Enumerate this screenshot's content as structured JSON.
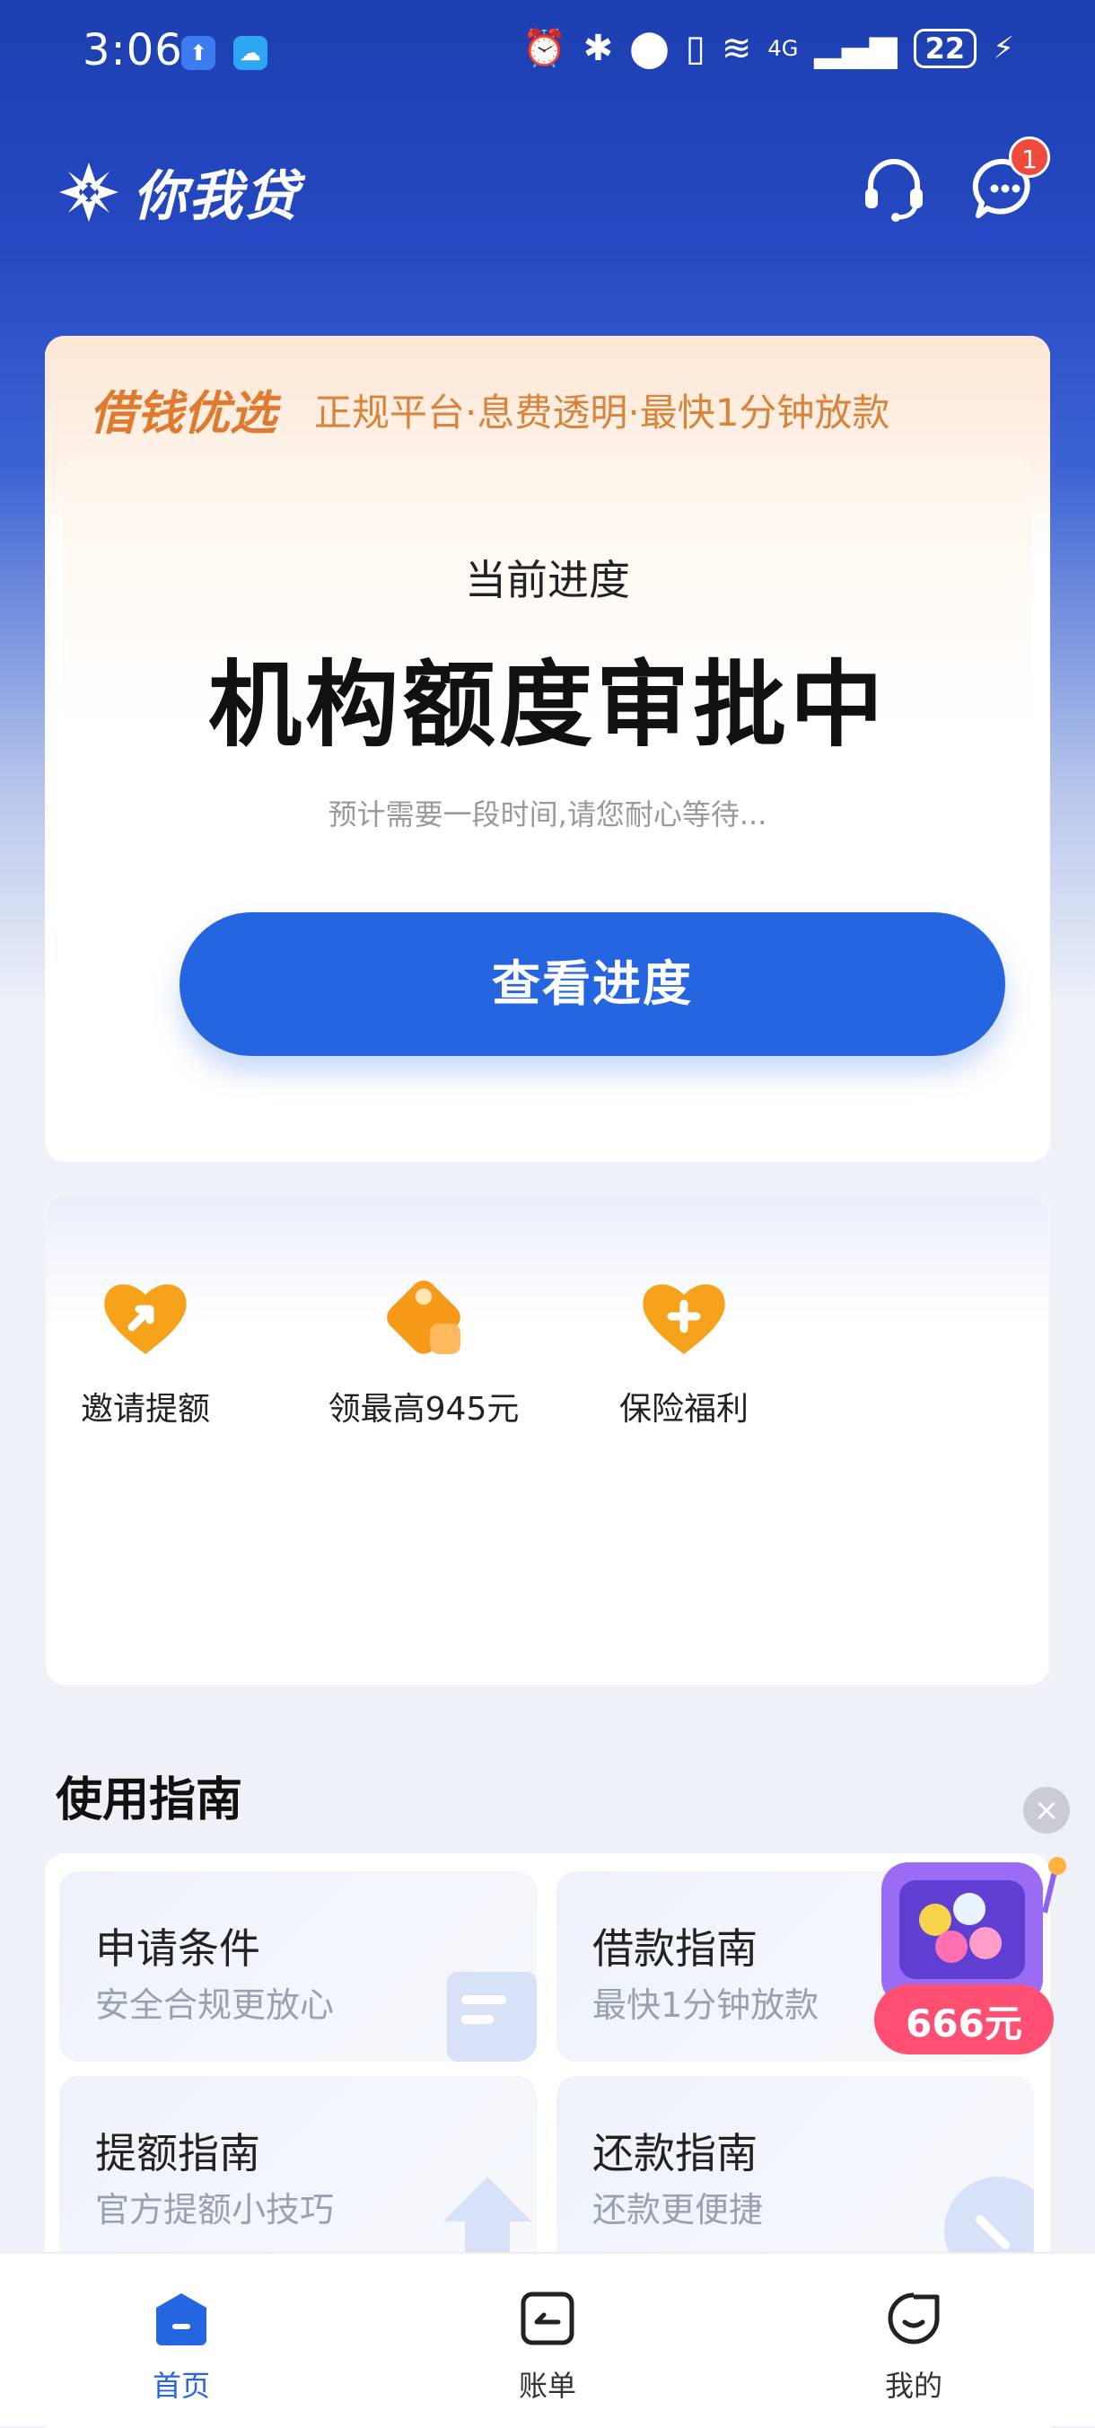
{
  "status_bar": {
    "time": "3:06",
    "network": "4G",
    "battery": "22"
  },
  "header": {
    "app_name": "你我贷",
    "message_badge": "1"
  },
  "loan_card": {
    "promo_title": "借钱优选",
    "promo_subtitle": "正规平台·息费透明·最快1分钟放款",
    "progress_label": "当前进度",
    "status": "机构额度审批中",
    "hint": "预计需要一段时间,请您耐心等待...",
    "button_label": "查看进度"
  },
  "features": [
    {
      "label": "邀请提额",
      "icon": "heart-arrow-icon"
    },
    {
      "label": "领最高945元",
      "icon": "coupon-icon"
    },
    {
      "label": "保险福利",
      "icon": "heart-plus-icon"
    }
  ],
  "guide": {
    "title": "使用指南",
    "items": [
      {
        "title": "申请条件",
        "subtitle": "安全合规更放心"
      },
      {
        "title": "借款指南",
        "subtitle": "最快1分钟放款"
      },
      {
        "title": "提额指南",
        "subtitle": "官方提额小技巧"
      },
      {
        "title": "还款指南",
        "subtitle": "还款更便捷"
      }
    ]
  },
  "float_promo": {
    "amount": "666元"
  },
  "tabbar": {
    "items": [
      {
        "label": "首页",
        "icon": "home-icon",
        "active": true
      },
      {
        "label": "账单",
        "icon": "bill-icon",
        "active": false
      },
      {
        "label": "我的",
        "icon": "profile-icon",
        "active": false
      }
    ]
  },
  "colors": {
    "primary": "#2566e0",
    "header_bg": "#1c3fb0",
    "promo_orange": "#e07a2e",
    "badge_red": "#f04a3c"
  }
}
